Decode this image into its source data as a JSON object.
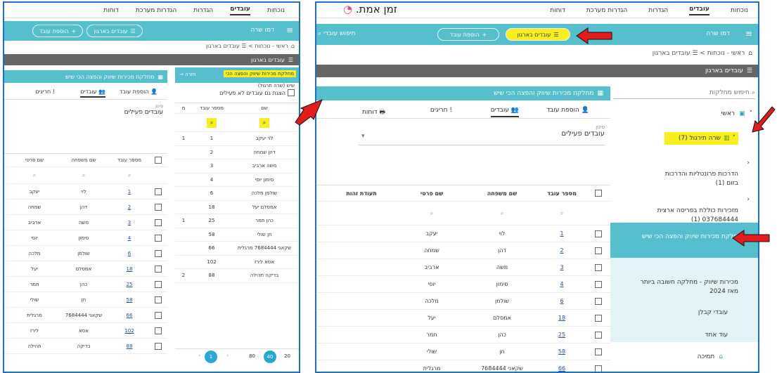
{
  "right_window": {
    "logo": "זמן אמת.",
    "nav": [
      "נוכחות",
      "עובדים",
      "הגדרות",
      "הגדרות מערכת",
      "דוחות"
    ],
    "nav_active": 1,
    "toolbar": {
      "menu": "דמו שרה",
      "btn_org": "עובדים בארגון",
      "btn_add": "הוספת עובד",
      "search": "חיפוש עובדי"
    },
    "breadcrumb": "ראשי - נוכחות  >  ☰ עובדים בארגון",
    "group_bar": "עובדים בארגון",
    "dept_search": "חיפוש מחלקות",
    "tree": {
      "root": "ראשי",
      "drill": "שרה תירגול (7)",
      "items": [
        "הדרכות פרונטליות והדרכות בזום (1)",
        "מזכירות כוללת בפריסה ארצית 037684444 (1)",
        "מחלקת מכירות שיווק והפצה הכי שיש",
        "מכירות שיווק - מחלקה חשובה ביותר מאז 2024",
        "עובדי קבלן",
        "עוד אחד"
      ],
      "support": "תמיכה"
    },
    "panel_title": "מחלקת מכירות שיווק והפצה הכי שיש",
    "tabs": [
      "הוספת עובד",
      "עובדים",
      "חריגים",
      "דוחות"
    ],
    "filter_label": "סינון",
    "filter_value": "עובדים פעילים",
    "columns": [
      "מספר עובד",
      "שם משפחה",
      "שם פרטי",
      "תעודת זהות"
    ],
    "rows": [
      [
        "1",
        "לוי",
        "יעקב"
      ],
      [
        "2",
        "דהן",
        "שמחה"
      ],
      [
        "3",
        "משה",
        "ארביב"
      ],
      [
        "4",
        "סימון",
        "יוסי"
      ],
      [
        "6",
        "שולמן",
        "מלכה"
      ],
      [
        "18",
        "אמסלם",
        "יעל"
      ],
      [
        "25",
        "כהן",
        "תמר"
      ],
      [
        "58",
        "חן",
        "שולי"
      ],
      [
        "66",
        "שקאני 7684444",
        "מרגלית"
      ]
    ]
  },
  "left_window": {
    "nav": [
      "נוכחות",
      "עובדים",
      "הגדרות",
      "הגדרות מערכת",
      "דוחות"
    ],
    "nav_active": 1,
    "toolbar": {
      "menu": "דמו שרה",
      "btn_org": "עובדים בארגון",
      "btn_add": "הוספת עובד"
    },
    "breadcrumb": "ראשי - נוכחות  >  ☰ עובדים בארגון",
    "group_bar": "עובדים בארגון",
    "back": "חזרה",
    "mini_dept": "מחלקת מכירות שיווק והפצה הכי",
    "mini_sub": "שיש (שרה תרגול)",
    "show_inactive": "הצגת גם עובדים לא פעילים",
    "mini_cols": [
      "שם",
      "מספר עובד",
      "מ"
    ],
    "mini_rows": [
      [
        "לוי יעקב",
        "1",
        "1"
      ],
      [
        "דהן שמחה",
        "2",
        ""
      ],
      [
        "משה ארביב",
        "3",
        ""
      ],
      [
        "סימון יוסי",
        "4",
        ""
      ],
      [
        "שולמן מלכה",
        "6",
        ""
      ],
      [
        "אמסלם יעל",
        "18",
        ""
      ],
      [
        "כהן תמר",
        "25",
        "1"
      ],
      [
        "חן שולי",
        "58",
        ""
      ],
      [
        "שקאני 7684444 מרגלית",
        "66",
        ""
      ],
      [
        "אסא לירז",
        "102",
        ""
      ],
      [
        "בדיקה תהילה",
        "88",
        "2"
      ]
    ],
    "pager": [
      "20",
      "40",
      "80",
      "1"
    ],
    "panel_title": "מחלקת מכירות שיווק והפצה הכי שיש",
    "tabs": [
      "הוספת עובד",
      "עובדים",
      "חריגים"
    ],
    "filter_label": "סינון",
    "filter_value": "עובדים פעילים",
    "columns": [
      "מספר עובד",
      "שם משפחה",
      "שם פרטי"
    ],
    "rows": [
      [
        "1",
        "לוי",
        "יעקב"
      ],
      [
        "2",
        "דהן",
        "שמחה"
      ],
      [
        "3",
        "משה",
        "ארביב"
      ],
      [
        "4",
        "סימון",
        "יוסי"
      ],
      [
        "6",
        "שולמן",
        "מלכה"
      ],
      [
        "18",
        "אמסלם",
        "יעל"
      ],
      [
        "25",
        "כהן",
        "תמר"
      ],
      [
        "58",
        "חן",
        "שולי"
      ],
      [
        "66",
        "שקאני 7684444",
        "מרגלית"
      ],
      [
        "102",
        "אסא",
        "לירז"
      ],
      [
        "88",
        "בדיקה",
        "תהילה"
      ]
    ]
  },
  "colors": {
    "teal": "#55bfcd",
    "highlight": "#f8ef1c",
    "arrow": "#e31b1b",
    "frame": "#1e6fc8"
  }
}
